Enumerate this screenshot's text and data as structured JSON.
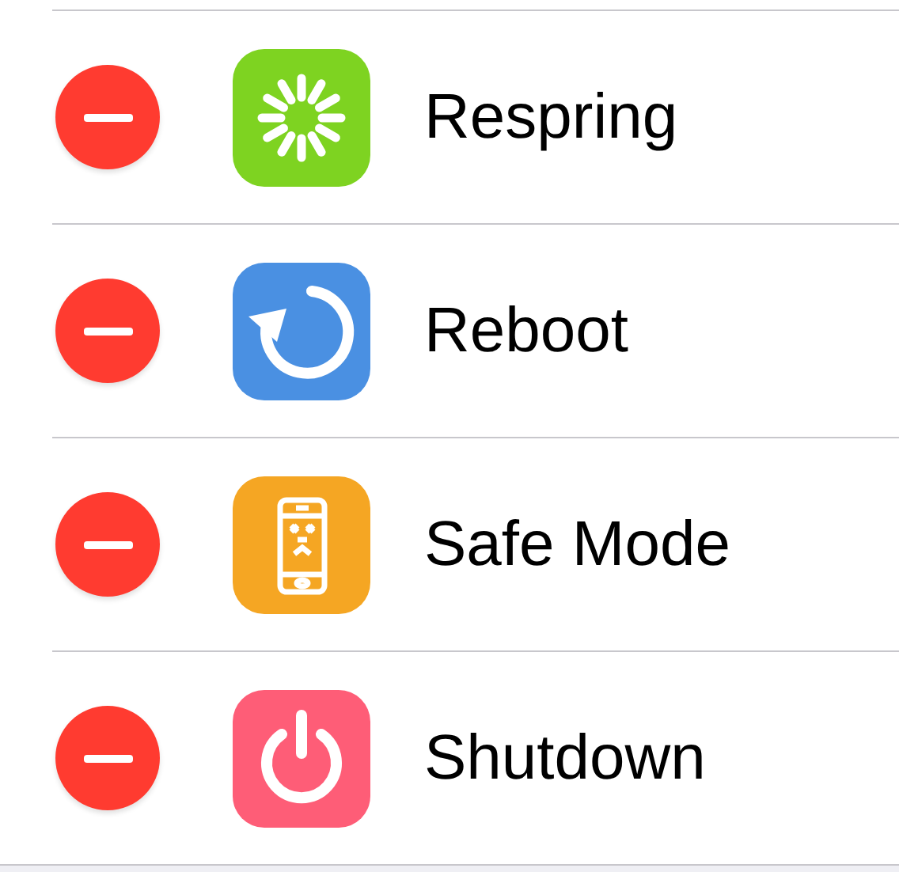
{
  "rows": [
    {
      "label": "Respring",
      "icon": {
        "kind": "spinner",
        "color": "#7ed321"
      }
    },
    {
      "label": "Reboot",
      "icon": {
        "kind": "reboot",
        "color": "#4a90e2"
      }
    },
    {
      "label": "Safe Mode",
      "icon": {
        "kind": "phone",
        "color": "#f5a623"
      }
    },
    {
      "label": "Shutdown",
      "icon": {
        "kind": "power",
        "color": "#fe5d77"
      }
    }
  ]
}
